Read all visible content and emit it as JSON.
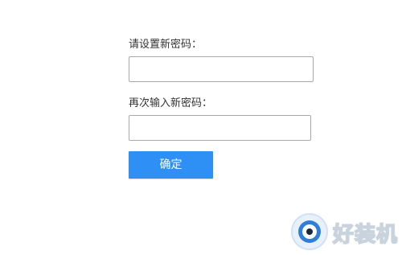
{
  "form": {
    "new_password_label": "请设置新密码：",
    "new_password_value": "",
    "confirm_password_label": "再次输入新密码：",
    "confirm_password_value": "",
    "confirm_button_label": "确定"
  },
  "watermark": {
    "text": "好装机"
  },
  "colors": {
    "button_bg": "#2e8ff5",
    "button_text": "#ffffff",
    "field_border": "#a9a9a9",
    "label_text": "#333333"
  }
}
